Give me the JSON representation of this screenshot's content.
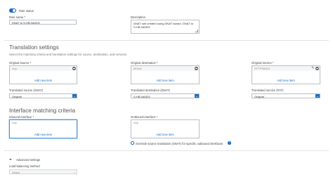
{
  "rule": {
    "status_label": "Rule status",
    "name_label": "Rule name *",
    "name_value": "DNAT to S-HB-NAS03",
    "description_label": "Description",
    "description_value": "DNAT rule created using DNAT wizard. DNAT to S-HB-NAS03"
  },
  "translation": {
    "title": "Translation settings",
    "subtitle": "Select the matching criteria and translation settings for source, destination, and services",
    "original_source": {
      "label": "Original source *",
      "value": "Any",
      "add": "Add new item"
    },
    "original_destination": {
      "label": "Original destination *",
      "value": "#Port2",
      "add": "Add new item"
    },
    "original_service": {
      "label": "Original service *",
      "value": "HTTPS5003",
      "add": "Add new item"
    },
    "translated_source": {
      "label": "Translated source (SNAT)",
      "value": "Original"
    },
    "translated_destination": {
      "label": "Translated destination (DNAT)",
      "value": "S-HB-NAS03"
    },
    "translated_service": {
      "label": "Translated service (PAT)",
      "value": "Original"
    }
  },
  "interface": {
    "title": "Interface matching criteria",
    "inbound": {
      "label": "Inbound interface *",
      "value": "Any",
      "add": "Add new item"
    },
    "outbound": {
      "label": "Outbound interface *",
      "value": "Any",
      "add": "Add new item"
    },
    "override_label": "Override source translation (SNAT) for specific outbound interfaces"
  },
  "advanced": {
    "label": "Advanced settings",
    "lb_label": "Load balancing method",
    "lb_value": "Select"
  },
  "colors": {
    "accent": "#1c6fc4",
    "toggle": "#1a6bc7"
  }
}
